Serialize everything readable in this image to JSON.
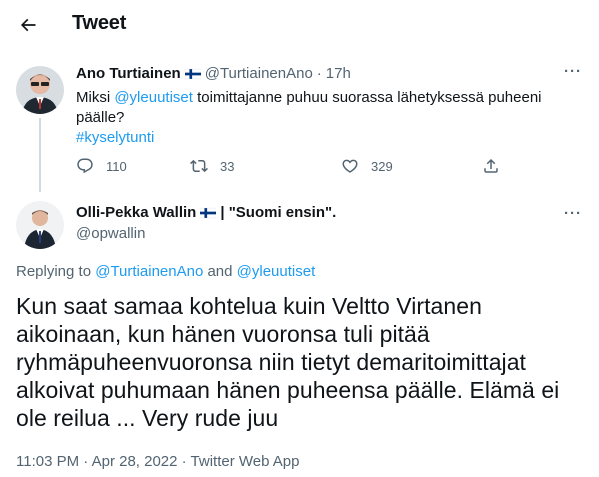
{
  "header": {
    "title": "Tweet"
  },
  "parent_tweet": {
    "name": "Ano Turtiainen",
    "handle": "@TurtiainenAno",
    "separator": "·",
    "time": "17h",
    "more": "···",
    "text_before": "Miksi ",
    "mention": "@yleuutiset",
    "text_after": " toimittajanne puhuu suorassa lähetyksessä puheeni päälle?",
    "hashtag": "#kyselytunti",
    "replies": "110",
    "retweets": "33",
    "likes": "329"
  },
  "main_tweet": {
    "name": "Olli-Pekka Wallin",
    "name_suffix": " | \"Suomi ensin\".",
    "handle": "@opwallin",
    "more": "···",
    "replying_prefix": "Replying to ",
    "replying_to_1": "@TurtiainenAno",
    "replying_and": " and ",
    "replying_to_2": "@yleuutiset",
    "text": "Kun saat samaa kohtelua kuin Veltto Virtanen aikoinaan, kun hänen vuoronsa tuli pitää ryhmäpuheenvuoronsa niin tietyt demaritoimittajat alkoivat puhumaan hänen puheensa päälle. Elämä ei ole reilua ... Very rude juu",
    "timestamp": "11:03 PM · Apr 28, 2022 · Twitter Web App"
  },
  "colors": {
    "link": "#1d9bf0",
    "secondary": "#536471",
    "primary": "#0f1419",
    "thread_line": "#cfd9de"
  }
}
